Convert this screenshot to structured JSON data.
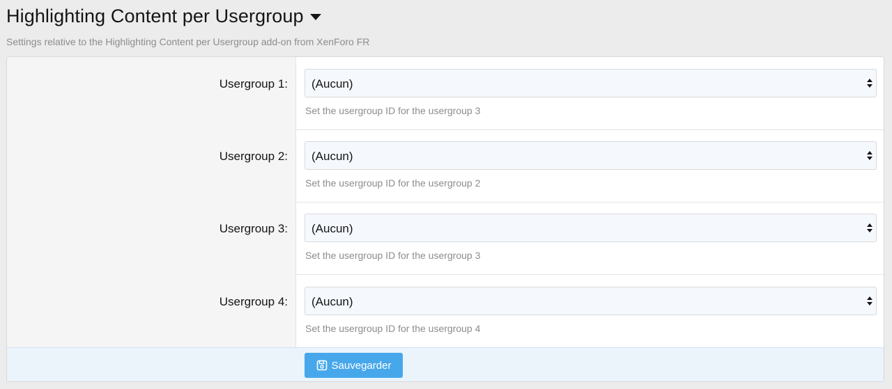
{
  "header": {
    "title": "Highlighting Content per Usergroup",
    "description": "Settings relative to the Highlighting Content per Usergroup add-on from XenForo FR"
  },
  "rows": [
    {
      "label": "Usergroup 1:",
      "value": "(Aucun)",
      "hint": "Set the usergroup ID for the usergroup 3"
    },
    {
      "label": "Usergroup 2:",
      "value": "(Aucun)",
      "hint": "Set the usergroup ID for the usergroup 2"
    },
    {
      "label": "Usergroup 3:",
      "value": "(Aucun)",
      "hint": "Set the usergroup ID for the usergroup 3"
    },
    {
      "label": "Usergroup 4:",
      "value": "(Aucun)",
      "hint": "Set the usergroup ID for the usergroup 4"
    }
  ],
  "submit": {
    "label": "Sauvegarder",
    "icon": "save-icon"
  },
  "colors": {
    "accent": "#47a7eb",
    "submit_bar": "#ebf3fb",
    "select_bg": "#f5f9fd"
  }
}
